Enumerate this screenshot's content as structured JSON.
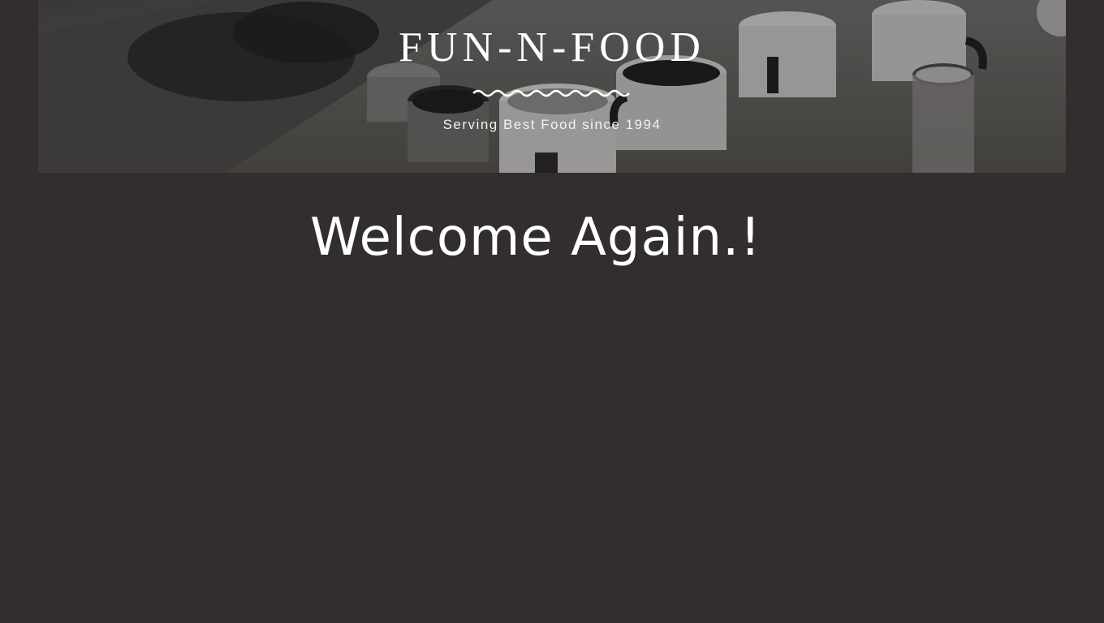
{
  "header": {
    "title": "FUN-N-FOOD",
    "tagline": "Serving Best Food since 1994",
    "background": "photo-of-enamel-mugs-on-table"
  },
  "main": {
    "heading": "Welcome Again.!"
  },
  "colors": {
    "page_background": "#322e2e",
    "text": "#ffffff"
  }
}
